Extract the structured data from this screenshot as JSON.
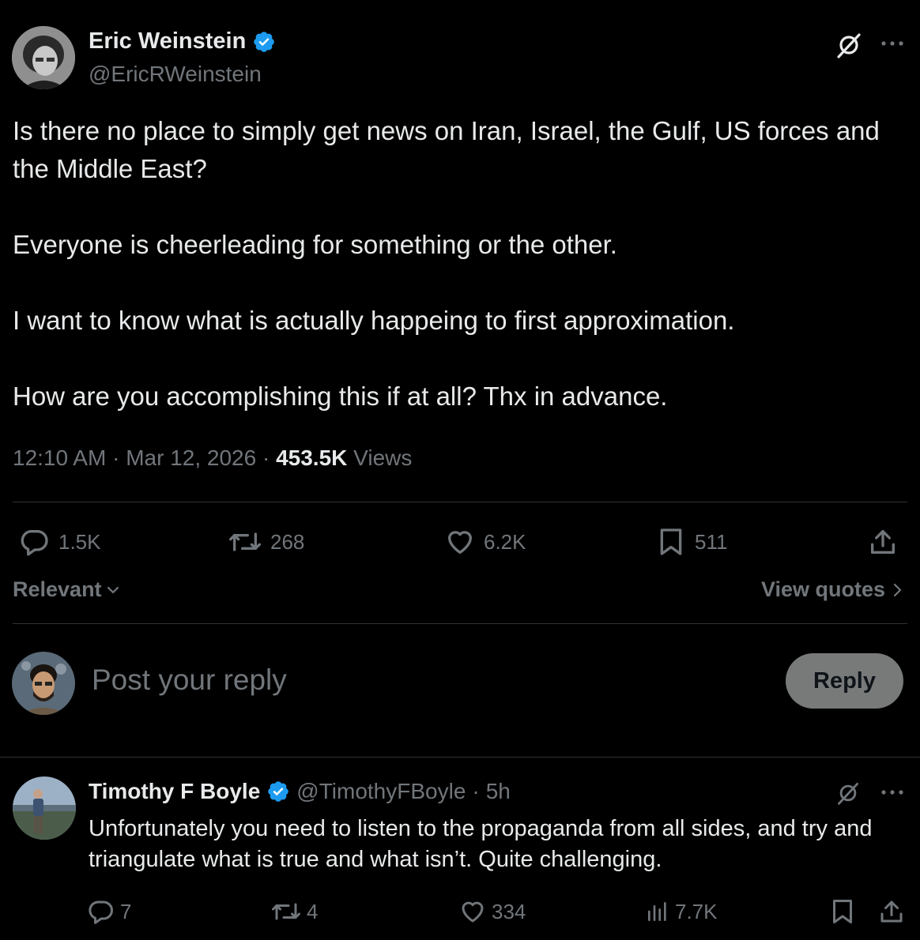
{
  "main_post": {
    "author_name": "Eric Weinstein",
    "author_handle": "@EricRWeinstein",
    "paragraphs": [
      "Is there no place to simply get news on Iran, Israel, the Gulf, US forces and the Middle East?",
      "Everyone is cheerleading for something or the other.",
      "I want to know what is actually happeing to first approximation.",
      "How are you accomplishing this if at all? Thx in advance."
    ],
    "time": "12:10 AM",
    "date": "Mar 12, 2026",
    "sep": "·",
    "views_count": "453.5K",
    "views_label": "Views",
    "stats": {
      "replies": "1.5K",
      "reposts": "268",
      "likes": "6.2K",
      "bookmarks": "511"
    }
  },
  "sort": {
    "label": "Relevant",
    "view_quotes": "View quotes"
  },
  "compose": {
    "placeholder": "Post your reply",
    "reply_button": "Reply"
  },
  "reply": {
    "author_name": "Timothy F Boyle",
    "author_handle": "@TimothyFBoyle",
    "sep": "·",
    "time_ago": "5h",
    "text": "Unfortunately you need to listen to the propaganda from all sides, and try and triangulate what is true and what isn’t. Quite challenging.",
    "stats": {
      "replies": "7",
      "reposts": "4",
      "likes": "334",
      "views": "7.7K"
    }
  },
  "colors": {
    "background": "#000000",
    "text": "#e7e9ea",
    "muted": "#71767b",
    "verified": "#1d9bf0",
    "divider": "#2f3336",
    "reply_button_bg": "#787a7a"
  },
  "icons": [
    "grok-icon",
    "more-icon",
    "verified-badge-icon",
    "reply-icon",
    "repost-icon",
    "like-icon",
    "bookmark-icon",
    "share-icon",
    "views-icon",
    "chevron-down-icon",
    "chevron-right-icon"
  ]
}
